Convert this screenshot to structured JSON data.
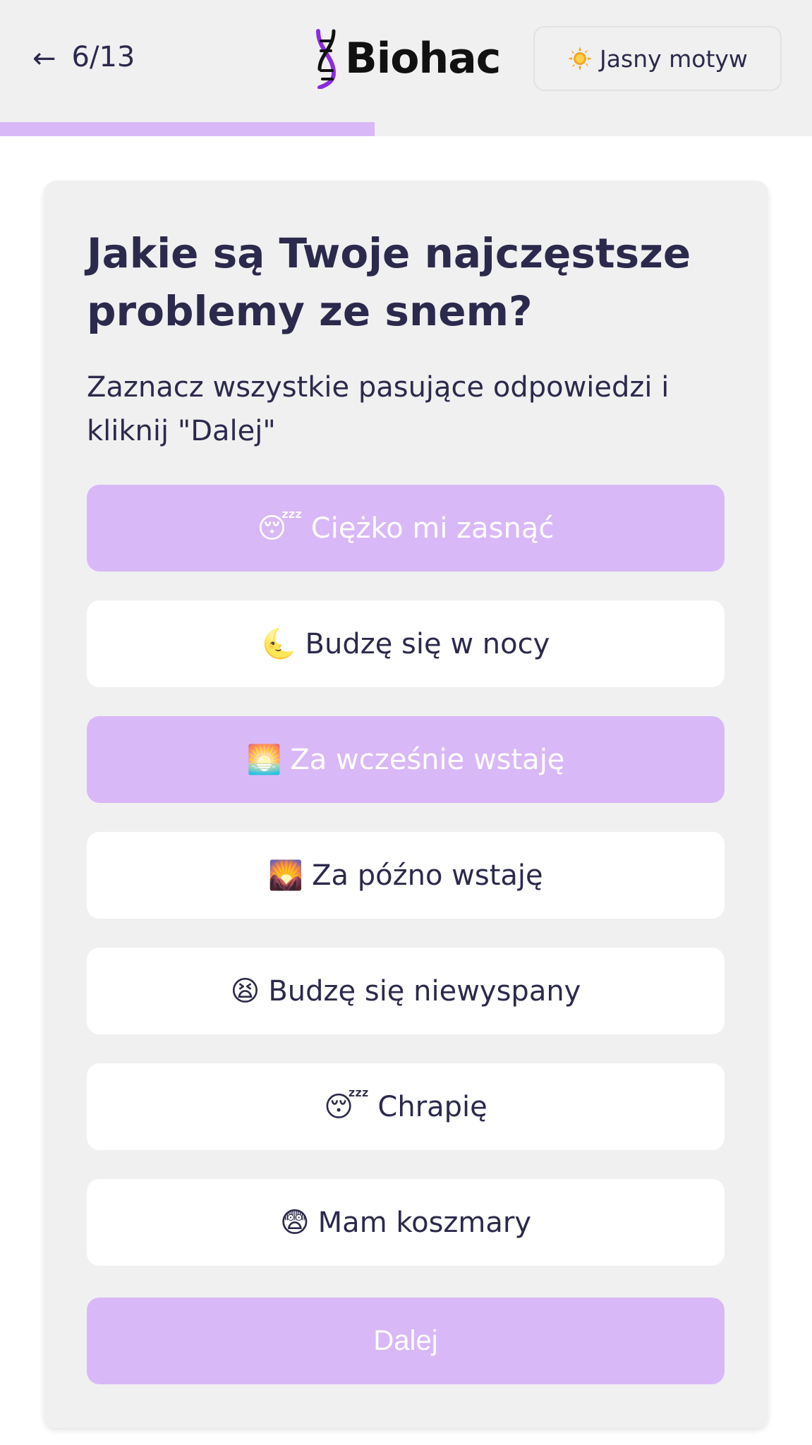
{
  "header": {
    "back_arrow": "←",
    "step": "6/13",
    "logo_text": "Biohac",
    "theme_button_label": "Jasny motyw",
    "theme_icon": "sun-icon"
  },
  "progress": {
    "fraction": 0.4615,
    "color": "#d9b8f7"
  },
  "question": {
    "title": "Jakie są Twoje najczęstsze problemy ze snem?",
    "subtitle": "Zaznacz wszystkie pasujące odpowiedzi i kliknij \"Dalej\""
  },
  "options": [
    {
      "emoji": "😴",
      "label": "Ciężko mi zasnąć",
      "selected": true
    },
    {
      "emoji": "🌜",
      "label": "Budzę się w nocy",
      "selected": false
    },
    {
      "emoji": "🌅",
      "label": "Za wcześnie wstaję",
      "selected": true
    },
    {
      "emoji": "🌄",
      "label": "Za późno wstaję",
      "selected": false
    },
    {
      "emoji": "😫",
      "label": "Budzę się niewyspany",
      "selected": false
    },
    {
      "emoji": "😴",
      "label": "Chrapię",
      "selected": false
    },
    {
      "emoji": "😨",
      "label": "Mam koszmary",
      "selected": false
    }
  ],
  "next_button": {
    "label": "Dalej"
  },
  "colors": {
    "accent": "#d9b8f7",
    "text": "#2b2a4c",
    "header_bg": "#f0f0f1",
    "card_bg": "#f0f0f1"
  }
}
